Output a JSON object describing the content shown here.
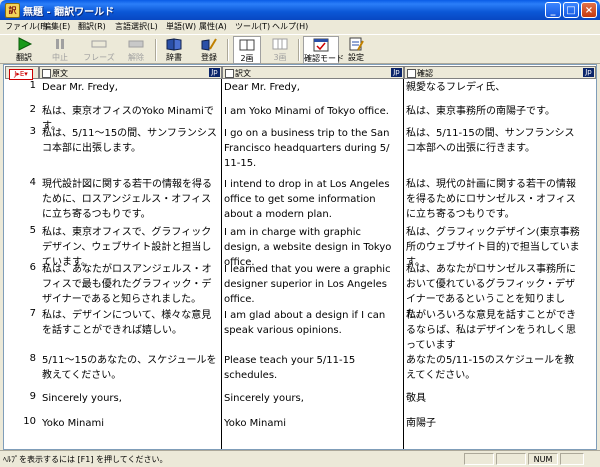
{
  "window": {
    "title": "無題 - 翻訳ワールド",
    "app_icon_glyph": "訳",
    "minimize_glyph": "_",
    "maximize_glyph": "□",
    "close_glyph": "×"
  },
  "menu": [
    "ファイル(F)",
    "編集(E)",
    "翻訳(R)",
    "言語選択(L)",
    "単語(W)",
    "属性(A)",
    "ツール(T)",
    "ヘルプ(H)"
  ],
  "toolbar": {
    "translate": "翻訳",
    "stop": "中止",
    "phrase": "フレーズ",
    "cancel": "解除",
    "dictionary": "辞書",
    "register": "登録",
    "two_pane": "2画",
    "three_pane": "3画",
    "confirm_mode": "確認モード",
    "settings": "設定"
  },
  "columns": {
    "selector": "J▸E▾",
    "source": "原文",
    "translation": "訳文",
    "back_translation": "確認",
    "pane_icon": "Jp"
  },
  "rows": [
    {
      "n": "1",
      "src": "Dear Mr. Fredy,",
      "tgt": "Dear Mr. Fredy,",
      "chk": "親愛なるフレディ氏、"
    },
    {
      "n": "2",
      "src": "私は、東京オフィスのYoko Minamiです。",
      "tgt": "I am Yoko Minami of Tokyo office.",
      "chk": "私は、東京事務所の南陽子です。"
    },
    {
      "n": "3",
      "src": "私は、5/11～15の間、サンフランシスコ本部に出張します。",
      "tgt": "I go on a business trip to the San Francisco headquarters during 5/ 11-15.",
      "chk": "私は、5/11-15の間、サンフランシスコ本部への出張に行きます。"
    },
    {
      "n": "4",
      "src": "現代設計図に関する若干の情報を得るために、ロスアンジェルス・オフィスに立ち寄るつもりです。",
      "tgt": "I intend to drop in at Los Angeles office to get some information about a modern plan.",
      "chk": "私は、現代の計画に関する若干の情報を得るためにロサンゼルス・オフィスに立ち寄るつもりです。"
    },
    {
      "n": "5",
      "src": "私は、東京オフィスで、グラフィックデザイン、ウェブサイト設計と担当しています。",
      "tgt": "I am in charge with graphic design, a website design in Tokyo office.",
      "chk": "私は、グラフィックデザイン(東京事務所のウェブサイト目的)で担当しています。"
    },
    {
      "n": "6",
      "src": "私は、あなたがロスアンジェルス・オフィスで最も優れたグラフィック・デザイナーであると知らされました。",
      "tgt": "I learned that you were a graphic designer superior in Los Angeles office.",
      "chk": "私は、あなたがロサンゼルス事務所において優れているグラフィック・デザイナーであるということを知りました。"
    },
    {
      "n": "7",
      "src": "私は、デザインについて、様々な意見を話すことができれば嬉しい。",
      "tgt": "I am glad about a design if I can speak various opinions.",
      "chk": "私がいろいろな意見を話すことができるならば、私はデザインをうれしく思っています"
    },
    {
      "n": "8",
      "src": "5/11～15のあなたの、スケジュールを教えてください。",
      "tgt": "Please teach your 5/11-15 schedules.",
      "chk": "あなたの5/11-15のスケジュールを教えてください。"
    },
    {
      "n": "9",
      "src": "Sincerely yours,",
      "tgt": "Sincerely yours,",
      "chk": "敬具"
    },
    {
      "n": "10",
      "src": "Yoko Minami",
      "tgt": "Yoko Minami",
      "chk": "南陽子"
    }
  ],
  "status": {
    "message": "ﾍﾙﾌﾟを表示するには [F1] を押してください。",
    "num": "NUM"
  }
}
